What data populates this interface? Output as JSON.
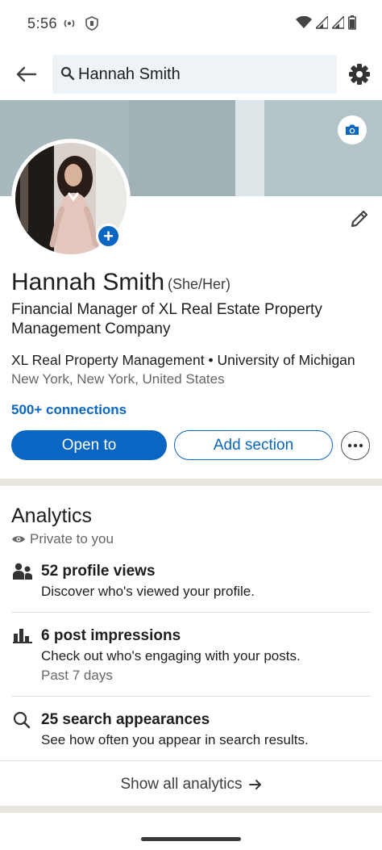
{
  "status_bar": {
    "time": "5:56"
  },
  "header": {
    "search_value": "Hannah Smith"
  },
  "profile": {
    "name": "Hannah Smith",
    "pronouns": "(She/Her)",
    "headline": "Financial Manager of XL Real Estate Property Management Company",
    "company_line": "XL Real Property Management • University of Michigan",
    "location": "New York, New York, United States",
    "connections": "500+ connections",
    "add_photo_symbol": "+"
  },
  "actions": {
    "open_to": "Open to",
    "add_section": "Add section"
  },
  "analytics": {
    "title": "Analytics",
    "privacy": "Private to you",
    "items": [
      {
        "icon": "people-icon",
        "title": "52 profile views",
        "desc": "Discover who's viewed your profile.",
        "sub": ""
      },
      {
        "icon": "bar-chart-icon",
        "title": "6 post impressions",
        "desc": "Check out who's engaging with your posts.",
        "sub": "Past 7 days"
      },
      {
        "icon": "search-icon",
        "title": "25 search appearances",
        "desc": "See how often you appear in search results.",
        "sub": ""
      }
    ],
    "show_all": "Show all analytics"
  },
  "colors": {
    "accent": "#0a66c2",
    "divider": "#e9e5df",
    "search_bg": "#eef3f8"
  }
}
